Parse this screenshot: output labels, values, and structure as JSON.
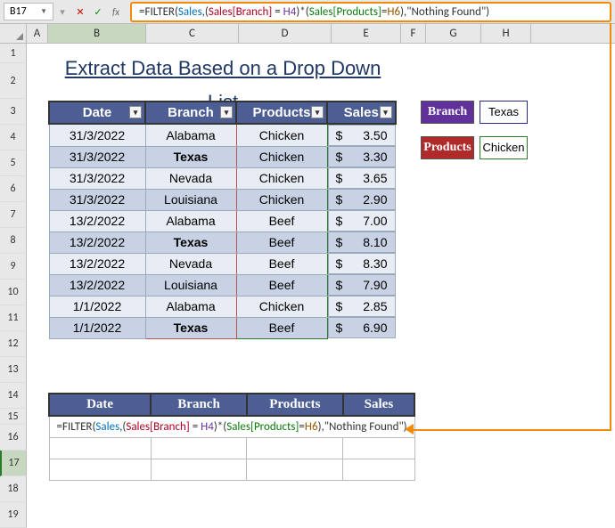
{
  "nameBox": "B17",
  "formulaBar": "=FILTER(Sales,(Sales[Branch] = H4)*(Sales[Products]=H6),\"Nothing Found\")",
  "title": "Extract Data Based on a Drop Down List",
  "columns": [
    "A",
    "B",
    "C",
    "D",
    "E",
    "F",
    "G",
    "H"
  ],
  "rows": [
    "1",
    "2",
    "3",
    "4",
    "5",
    "6",
    "7",
    "8",
    "9",
    "10",
    "11",
    "12",
    "13",
    "14",
    "15",
    "16",
    "17",
    "18",
    "19"
  ],
  "table1": {
    "headers": [
      "Date",
      "Branch",
      "Products",
      "Sales"
    ],
    "data": [
      {
        "date": "31/3/2022",
        "branch": "Alabama",
        "product": "Chicken",
        "sales": "3.50"
      },
      {
        "date": "31/3/2022",
        "branch": "Texas",
        "product": "Chicken",
        "sales": "3.30",
        "bold": true
      },
      {
        "date": "31/3/2022",
        "branch": "Nevada",
        "product": "Chicken",
        "sales": "3.65"
      },
      {
        "date": "31/3/2022",
        "branch": "Louisiana",
        "product": "Chicken",
        "sales": "2.90"
      },
      {
        "date": "13/2/2022",
        "branch": "Alabama",
        "product": "Beef",
        "sales": "7.00"
      },
      {
        "date": "13/2/2022",
        "branch": "Texas",
        "product": "Beef",
        "sales": "8.10",
        "bold": true
      },
      {
        "date": "13/2/2022",
        "branch": "Nevada",
        "product": "Beef",
        "sales": "8.30"
      },
      {
        "date": "13/2/2022",
        "branch": "Louisiana",
        "product": "Beef",
        "sales": "7.90"
      },
      {
        "date": "1/1/2022",
        "branch": "Alabama",
        "product": "Chicken",
        "sales": "2.85"
      },
      {
        "date": "1/1/2022",
        "branch": "Texas",
        "product": "Beef",
        "sales": "6.90",
        "bold": true
      }
    ]
  },
  "controls": {
    "branchLabel": "Branch",
    "branchValue": "Texas",
    "productsLabel": "Products",
    "productsValue": "Chicken"
  },
  "table2": {
    "headers": [
      "Date",
      "Branch",
      "Products",
      "Sales"
    ],
    "formulaCell": "=FILTER(Sales,(Sales[Branch] = H4)*(Sales[Products]=H6),\"Nothing Found\")"
  },
  "currencySymbol": "$"
}
